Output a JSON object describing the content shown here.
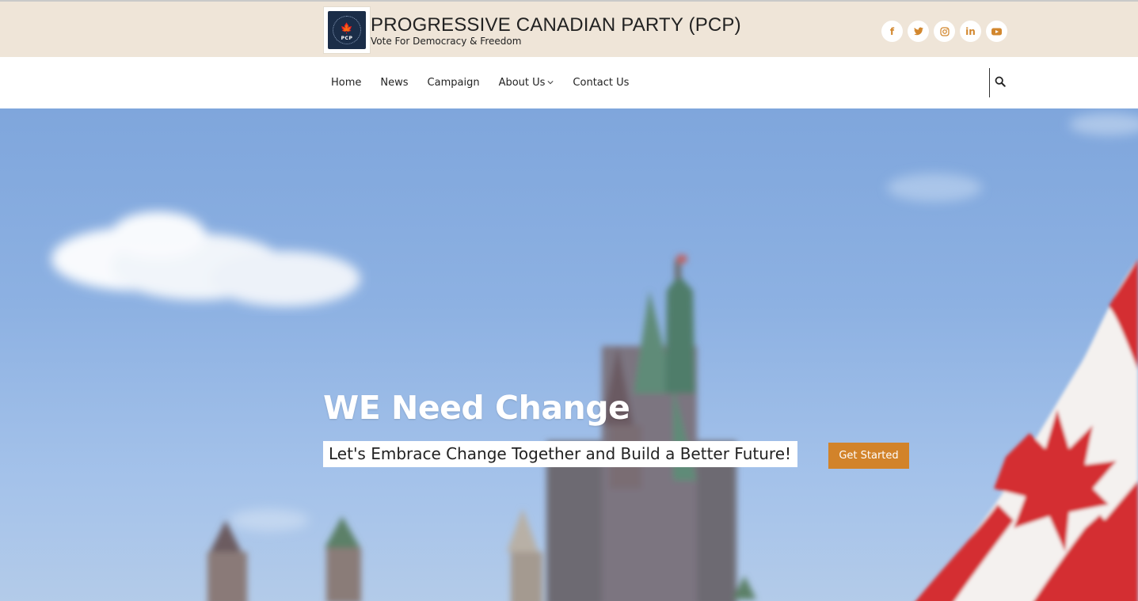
{
  "header": {
    "logo_text": "PCP",
    "site_title": "PROGRESSIVE CANADIAN PARTY (PCP)",
    "tagline": "Vote For Democracy & Freedom",
    "socials": [
      {
        "icon": "facebook-icon",
        "glyph": "f"
      },
      {
        "icon": "twitter-icon",
        "glyph": "🐦"
      },
      {
        "icon": "instagram-icon",
        "glyph": "◎"
      },
      {
        "icon": "linkedin-icon",
        "glyph": "in"
      },
      {
        "icon": "youtube-icon",
        "glyph": "▶"
      }
    ]
  },
  "nav": {
    "items": [
      {
        "label": "Home"
      },
      {
        "label": "News"
      },
      {
        "label": "Campaign"
      },
      {
        "label": "About Us",
        "dropdown": true
      },
      {
        "label": "Contact Us"
      }
    ],
    "search_icon": "search-icon"
  },
  "hero": {
    "title": "WE Need Change",
    "subtitle": "Let's Embrace Change Together and Build a Better Future!",
    "cta_label": "Get Started"
  },
  "colors": {
    "topbar_bg": "#efe5d8",
    "accent": "#d2832a",
    "social_icon": "#d2872e"
  }
}
